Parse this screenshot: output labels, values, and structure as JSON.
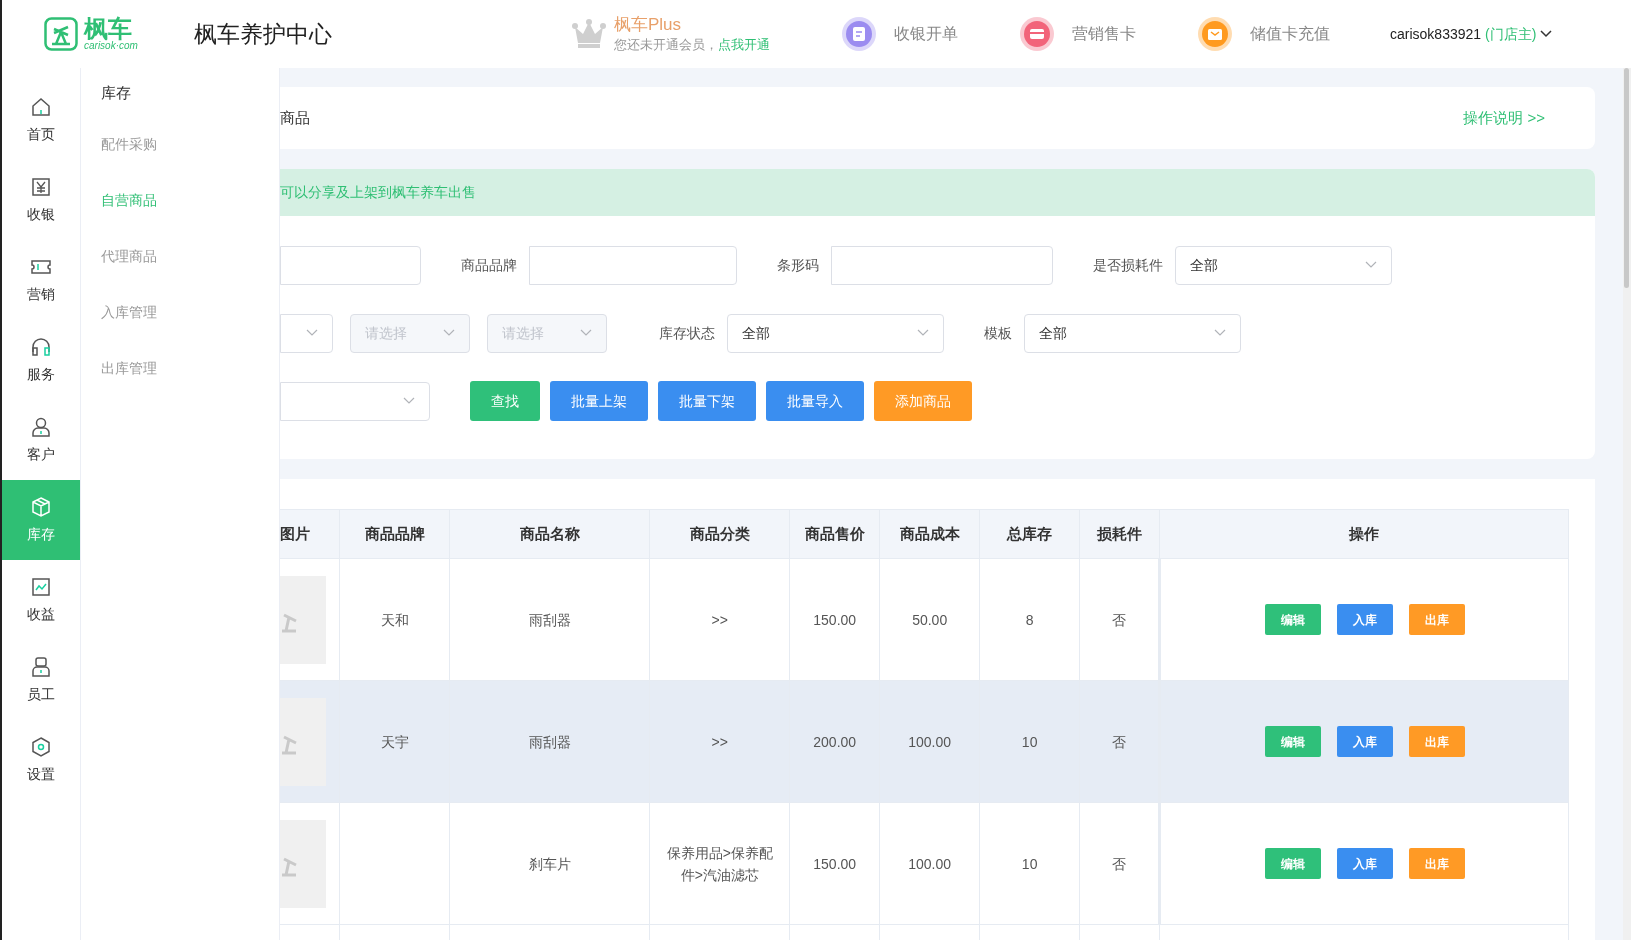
{
  "header": {
    "logo": {
      "brand": "枫车",
      "domain": "carisok·com"
    },
    "title": "枫车养护中心",
    "plus": {
      "title": "枫车Plus",
      "subtitle": "您还未开通会员，",
      "link": "点我开通"
    },
    "quick_actions": [
      {
        "label": "收银开单",
        "color": "#9b8cf0"
      },
      {
        "label": "营销售卡",
        "color": "#f2647a"
      },
      {
        "label": "储值卡充值",
        "color": "#ff9a1f"
      }
    ],
    "user": {
      "name": "carisok833921",
      "role": "(门店主)"
    }
  },
  "rail": [
    {
      "label": "首页",
      "selected": false
    },
    {
      "label": "收银",
      "selected": false
    },
    {
      "label": "营销",
      "selected": false
    },
    {
      "label": "服务",
      "selected": false
    },
    {
      "label": "客户",
      "selected": false
    },
    {
      "label": "库存",
      "selected": true
    },
    {
      "label": "收益",
      "selected": false
    },
    {
      "label": "员工",
      "selected": false
    },
    {
      "label": "设置",
      "selected": false
    }
  ],
  "submenu": {
    "title": "库存",
    "items": [
      {
        "label": "配件采购",
        "selected": false
      },
      {
        "label": "自营商品",
        "selected": true
      },
      {
        "label": "代理商品",
        "selected": false
      },
      {
        "label": "入库管理",
        "selected": false
      },
      {
        "label": "出库管理",
        "selected": false
      }
    ]
  },
  "breadcrumb": {
    "text": "商品",
    "help_link": "操作说明 >>"
  },
  "notice": "可以分享及上架到枫车养车出售",
  "filters": [
    [
      {
        "kind": "input"
      },
      {
        "kind": "input",
        "label": "商品品牌"
      },
      {
        "kind": "input",
        "label": "条形码"
      },
      {
        "kind": "select",
        "label": "是否损耗件",
        "value": "全部"
      }
    ],
    [
      {
        "kind": "select"
      },
      {
        "kind": "select",
        "placeholder": "请选择",
        "disabled": true
      },
      {
        "kind": "select",
        "placeholder": "请选择",
        "disabled": true
      },
      {
        "kind": "select",
        "label": "库存状态",
        "value": "全部"
      },
      {
        "kind": "select",
        "label": "模板",
        "value": "全部"
      }
    ],
    [
      {
        "kind": "select"
      }
    ]
  ],
  "buttons": [
    {
      "label": "查找",
      "kind": "success"
    },
    {
      "label": "批量上架",
      "kind": "primary"
    },
    {
      "label": "批量下架",
      "kind": "primary"
    },
    {
      "label": "批量导入",
      "kind": "primary"
    },
    {
      "label": "添加商品",
      "kind": "warning"
    }
  ],
  "table": {
    "columns": [
      "图片",
      "商品品牌",
      "商品名称",
      "商品分类",
      "商品售价",
      "商品成本",
      "总库存",
      "损耗件",
      "操作"
    ],
    "rows": [
      {
        "highlighted": false,
        "brand": "天和",
        "name": "雨刮器",
        "category": ">>",
        "price": "150.00",
        "cost": "50.00",
        "stock": "8",
        "consumable": "否",
        "actions": [
          {
            "label": "编辑",
            "kind": "success"
          },
          {
            "label": "入库",
            "kind": "primary"
          },
          {
            "label": "出库",
            "kind": "warning"
          }
        ]
      },
      {
        "highlighted": true,
        "brand": "天宇",
        "name": "雨刮器",
        "category": ">>",
        "price": "200.00",
        "cost": "100.00",
        "stock": "10",
        "consumable": "否",
        "actions": [
          {
            "label": "编辑",
            "kind": "success"
          },
          {
            "label": "入库",
            "kind": "primary"
          },
          {
            "label": "出库",
            "kind": "warning"
          }
        ]
      },
      {
        "highlighted": false,
        "name": "刹车片",
        "category": "保养用品>保养配件>汽油滤芯",
        "price": "150.00",
        "cost": "100.00",
        "stock": "10",
        "consumable": "否",
        "actions": [
          {
            "label": "编辑",
            "kind": "success"
          },
          {
            "label": "入库",
            "kind": "primary"
          },
          {
            "label": "出库",
            "kind": "warning"
          }
        ]
      }
    ]
  }
}
